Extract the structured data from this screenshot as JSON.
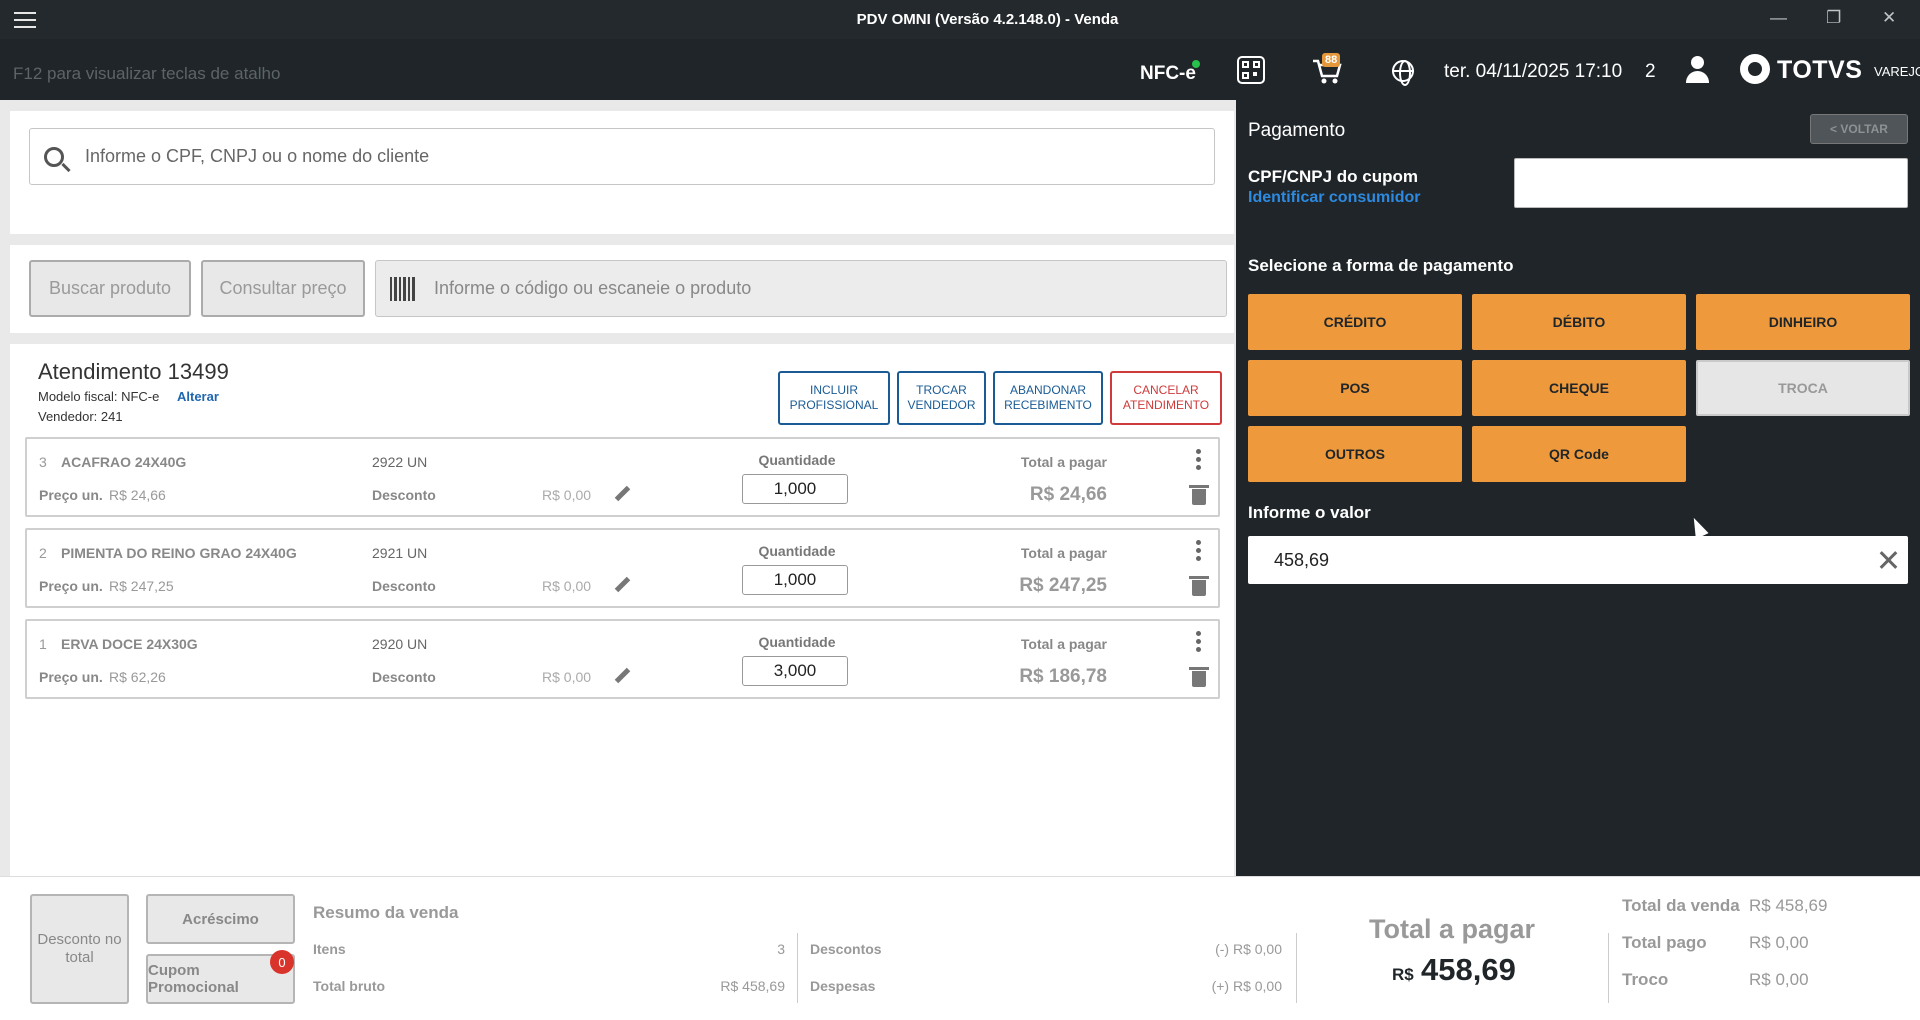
{
  "window": {
    "title": "PDV OMNI (Versão 4.2.148.0) - Venda"
  },
  "header": {
    "shortcut_hint": "F12 para visualizar teclas de atalho",
    "nfce_label": "NFC-e",
    "cart_badge": "88",
    "datetime": "ter. 04/11/2025 17:10",
    "user_count": "2",
    "brand": "TOTVS",
    "brand_suffix": "VAREJO"
  },
  "client": {
    "search_placeholder": "Informe o CPF, CNPJ ou o nome do cliente"
  },
  "product_bar": {
    "search_button": "Buscar produto",
    "price_button": "Consultar preço",
    "barcode_placeholder": "Informe o código ou escaneie o produto"
  },
  "atendimento": {
    "title": "Atendimento 13499",
    "model": "Modelo fiscal: NFC-e",
    "alterar": "Alterar",
    "vendor": "Vendedor: 241",
    "actions": {
      "incluir": [
        "INCLUIR",
        "PROFISSIONAL"
      ],
      "trocar": [
        "TROCAR",
        "VENDEDOR"
      ],
      "abandonar": [
        "ABANDONAR",
        "RECEBIMENTO"
      ],
      "cancelar": [
        "CANCELAR",
        "ATENDIMENTO"
      ]
    }
  },
  "items": [
    {
      "seq": "3",
      "name": "ACAFRAO 24X40G",
      "code": "2922  UN",
      "unit_label": "Preço un.",
      "unit_price": "R$ 24,66",
      "discount_label": "Desconto",
      "discount": "R$ 0,00",
      "qty_label": "Quantidade",
      "qty": "1,000",
      "total_label": "Total a pagar",
      "total": "R$ 24,66"
    },
    {
      "seq": "2",
      "name": "PIMENTA DO REINO GRAO 24X40G",
      "code": "2921  UN",
      "unit_label": "Preço un.",
      "unit_price": "R$ 247,25",
      "discount_label": "Desconto",
      "discount": "R$ 0,00",
      "qty_label": "Quantidade",
      "qty": "1,000",
      "total_label": "Total a pagar",
      "total": "R$ 247,25"
    },
    {
      "seq": "1",
      "name": "ERVA DOCE 24X30G",
      "code": "2920  UN",
      "unit_label": "Preço un.",
      "unit_price": "R$ 62,26",
      "discount_label": "Desconto",
      "discount": "R$ 0,00",
      "qty_label": "Quantidade",
      "qty": "3,000",
      "total_label": "Total a pagar",
      "total": "R$ 186,78"
    }
  ],
  "payment": {
    "title": "Pagamento",
    "back_button": "< VOLTAR",
    "cpf_label": "CPF/CNPJ do cupom",
    "identify_link": "Identificar consumidor",
    "cpf_value": "",
    "select_label": "Selecione a forma de pagamento",
    "methods": [
      "CRÉDITO",
      "DÉBITO",
      "DINHEIRO",
      "POS",
      "CHEQUE",
      "TROCA",
      "OUTROS",
      "QR Code"
    ],
    "value_label": "Informe o valor",
    "value": "458,69",
    "accent_color": "#ee9a3c"
  },
  "summary": {
    "desconto_total": "Desconto no total",
    "acrescimo": "Acréscimo",
    "cupom": "Cupom Promocional",
    "cupom_count": "0",
    "title": "Resumo da venda",
    "itens_label": "Itens",
    "itens_value": "3",
    "bruto_label": "Total bruto",
    "bruto_value": "R$ 458,69",
    "descontos_label": "Descontos",
    "descontos_value": "(-) R$ 0,00",
    "despesas_label": "Despesas",
    "despesas_value": "(+) R$ 0,00",
    "total_pagar_label": "Total a pagar",
    "total_pagar_currency": "R$",
    "total_pagar_value": "458,69",
    "total_venda_label": "Total da venda",
    "total_venda_value": "R$ 458,69",
    "total_pago_label": "Total pago",
    "total_pago_value": "R$ 0,00",
    "troco_label": "Troco",
    "troco_value": "R$ 0,00"
  }
}
